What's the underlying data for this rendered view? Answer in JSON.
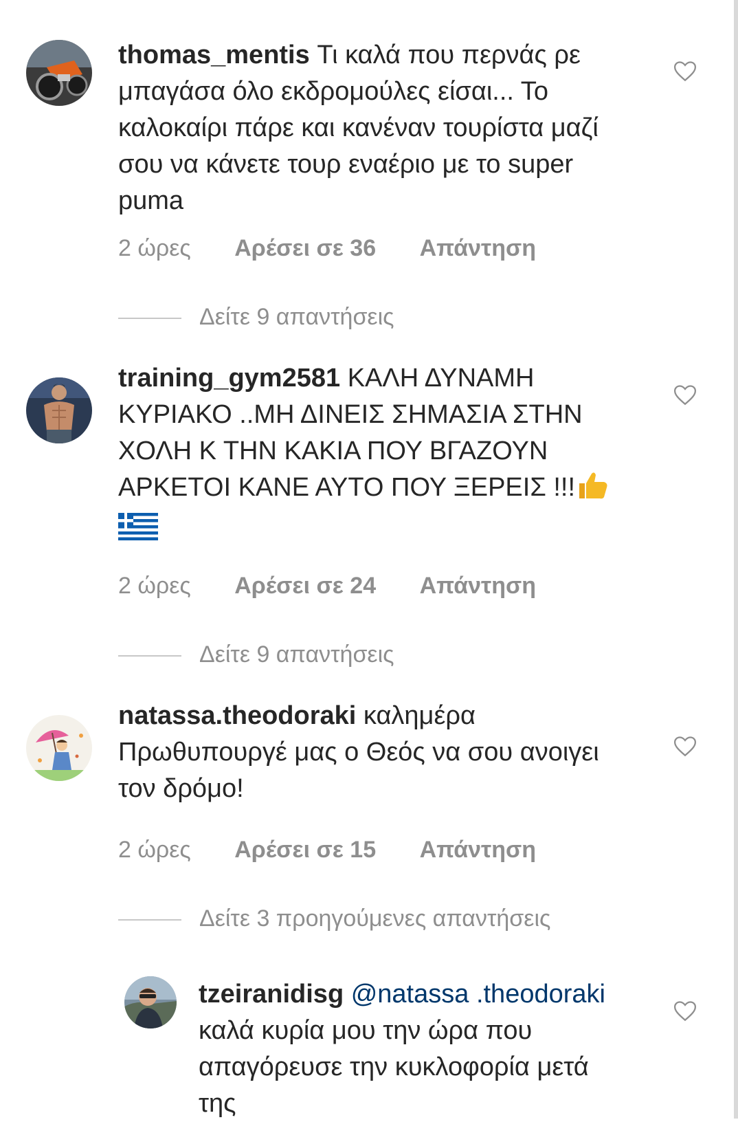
{
  "comments": [
    {
      "username": "thomas_mentis",
      "text": "Τι καλά που περνάς ρε μπαγάσα όλο εκδρομούλες είσαι... Το καλοκαίρι πάρε και κανέναν τουρίστα μαζί σου να κάνετε τουρ εναέριο με το super puma",
      "time": "2 ώρες",
      "likes": "Αρέσει σε 36",
      "reply": "Απάντηση",
      "view_replies": "Δείτε 9 απαντήσεις",
      "avatar_icon": "motorcycle-avatar"
    },
    {
      "username": "training_gym2581",
      "text": "ΚΑΛΗ ΔΥΝΑΜΗ ΚΥΡΙΑΚΟ ..ΜΗ ΔΙΝΕΙΣ ΣΗΜΑΣΙΑ ΣΤΗΝ ΧΟΛΗ Κ ΤΗΝ ΚΑΚΙΑ ΠΟΥ ΒΓΑΖΟΥΝ ΑΡΚΕΤΟΙ ΚΑΝΕ ΑΥΤΟ ΠΟΥ ΞΕΡΕΙΣ !!!",
      "emojis": [
        "thumbs-up-emoji",
        "greek-flag-emoji"
      ],
      "time": "2 ώρες",
      "likes": "Αρέσει σε 24",
      "reply": "Απάντηση",
      "view_replies": "Δείτε 9 απαντήσεις",
      "avatar_icon": "gym-avatar"
    },
    {
      "username": "natassa.theodoraki",
      "text": "καλημέρα Πρωθυπουργέ μας ο Θεός να σου ανοιγει τον δρόμο!",
      "time": "2 ώρες",
      "likes": "Αρέσει σε 15",
      "reply": "Απάντηση",
      "view_replies": "Δείτε 3 προηγούμενες απαντήσεις",
      "avatar_icon": "umbrella-girl-avatar"
    }
  ],
  "reply": {
    "username": "tzeiranidisg",
    "mention": "@natassa .theodoraki",
    "text": "καλά κυρία μου την ώρα που απαγόρευσε την κυκλοφορία μετά της",
    "avatar_icon": "person-avatar"
  },
  "colors": {
    "text": "#262626",
    "muted": "#8e8e8e",
    "mention": "#00376b",
    "divider": "#c7c7c7"
  },
  "icons": {
    "like": "heart-outline-icon"
  }
}
